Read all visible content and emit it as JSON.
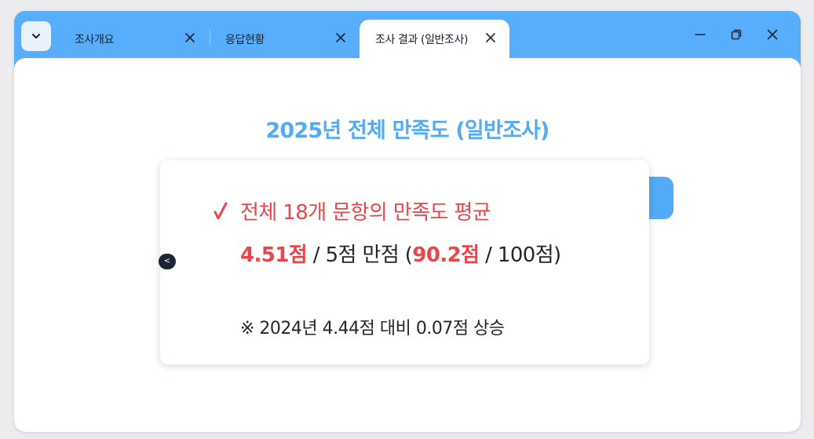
{
  "tabs": [
    {
      "label": "조사개요"
    },
    {
      "label": "응답현황"
    },
    {
      "label": "조사 결과 (일반조사)"
    }
  ],
  "icons": {
    "menu": "chevron-down-icon",
    "tab_close": "close-icon",
    "minimize": "minimize-icon",
    "restore": "restore-icon",
    "close": "close-icon",
    "check": "check-icon",
    "collapse": "chevron-left-icon"
  },
  "colors": {
    "titlebar": "#58aefc",
    "accent_blue": "#52abf6",
    "highlight_red": "#e8464b",
    "text_dark": "#22272e"
  },
  "main": {
    "title": "2025년 전체 만족도 (일반조사)",
    "collapse_label": "<",
    "card": {
      "heading": "전체 18개 문항의 만족도 평균",
      "score": "4.51점",
      "score_scale": " / 5점 만점 (",
      "score_100": "90.2점",
      "score_100_scale": " / 100점)",
      "note": "※ 2024년 4.44점 대비 0.07점 상승"
    }
  }
}
